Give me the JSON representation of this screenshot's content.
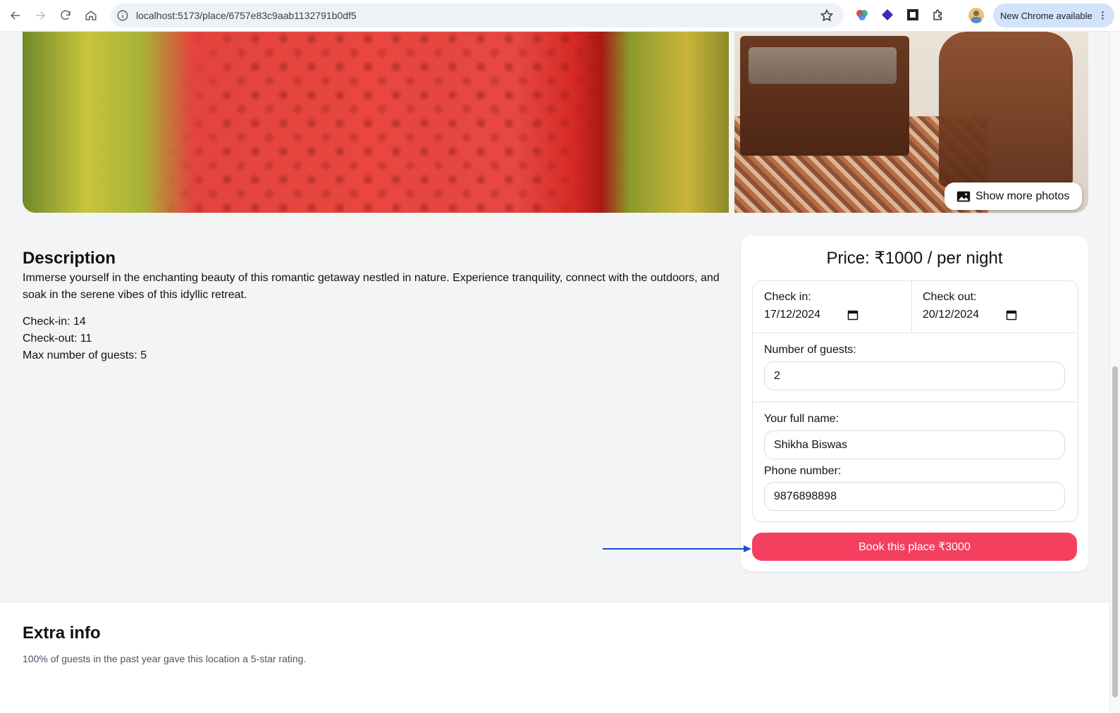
{
  "browser": {
    "url": "localhost:5173/place/6757e83c9aab1132791b0df5",
    "update_label": "New Chrome available"
  },
  "gallery": {
    "show_more_label": "Show more photos"
  },
  "description": {
    "title": "Description",
    "text": "Immerse yourself in the enchanting beauty of this romantic getaway nestled in nature. Experience tranquility, connect with the outdoors, and soak in the serene vibes of this idyllic retreat.",
    "check_in": "Check-in: 14",
    "check_out": "Check-out: 11",
    "max_guests": "Max number of guests: 5"
  },
  "booking": {
    "price_label": "Price: ₹1000 / per night",
    "check_in_label": "Check in:",
    "check_in_value": "17/12/2024",
    "check_out_label": "Check out:",
    "check_out_value": "20/12/2024",
    "guests_label": "Number of guests:",
    "guests_value": "2",
    "name_label": "Your full name:",
    "name_value": "Shikha Biswas",
    "phone_label": "Phone number:",
    "phone_value": "9876898898",
    "book_label": "Book this place ₹3000",
    "accent_color": "#f43f5e"
  },
  "extra": {
    "title": "Extra info",
    "text": "100% of guests in the past year gave this location a 5-star rating."
  },
  "annotation": {
    "arrow_color": "#1d4ed8"
  }
}
